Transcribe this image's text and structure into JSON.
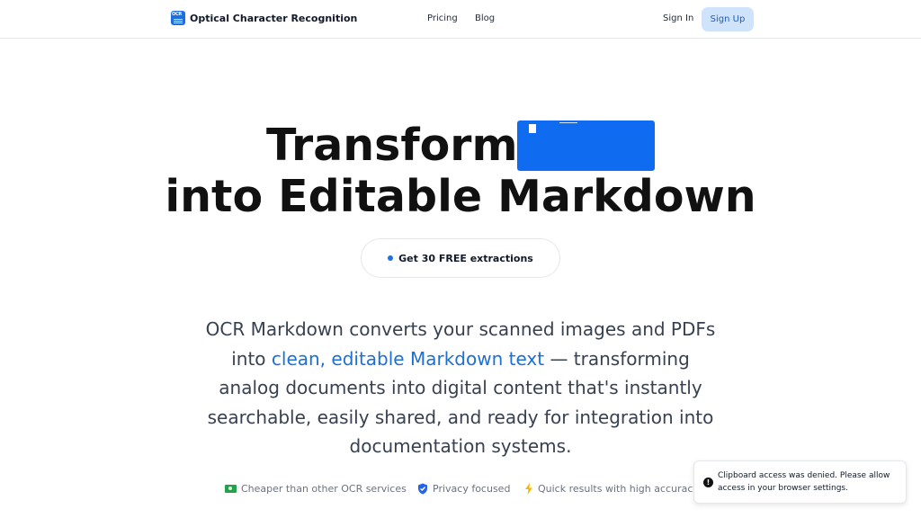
{
  "header": {
    "logo_icon_text": "OCR",
    "app_title": "Optical Character Recognition",
    "nav": [
      {
        "label": "Pricing"
      },
      {
        "label": "Blog"
      }
    ],
    "sign_in_label": "Sign In",
    "sign_up_label": "Sign Up"
  },
  "hero": {
    "title_line1": "Transform",
    "title_line2": "into Editable Markdown",
    "typing_box_color": "#0f6cf0",
    "badge_text": "Get 30 FREE extractions",
    "description": {
      "line1": "OCR Markdown converts your scanned images and PDFs",
      "line2_prefix": "into",
      "line2_highlight": "clean, editable Markdown text",
      "line2_suffix": "— transforming",
      "line3": "analog documents into digital content that's instantly",
      "line4": "searchable, easily shared, and ready for integration into",
      "line5": "documentation systems."
    },
    "features": [
      {
        "icon": "money-icon",
        "label": "Cheaper than other OCR services"
      },
      {
        "icon": "shield-icon",
        "label": "Privacy focused"
      },
      {
        "icon": "bolt-icon",
        "label": "Quick results with high accuracy"
      }
    ]
  },
  "toast": {
    "icon": "alert-icon",
    "icon_glyph": "!",
    "message": "Clipboard access was denied. Please allow access in your browser settings."
  },
  "colors": {
    "accent": "#1d6fd6",
    "sign_up_bg": "#cfe3fb",
    "money_icon": "#22a34a",
    "shield_icon": "#2563eb",
    "bolt_icon": "#f5b800"
  }
}
